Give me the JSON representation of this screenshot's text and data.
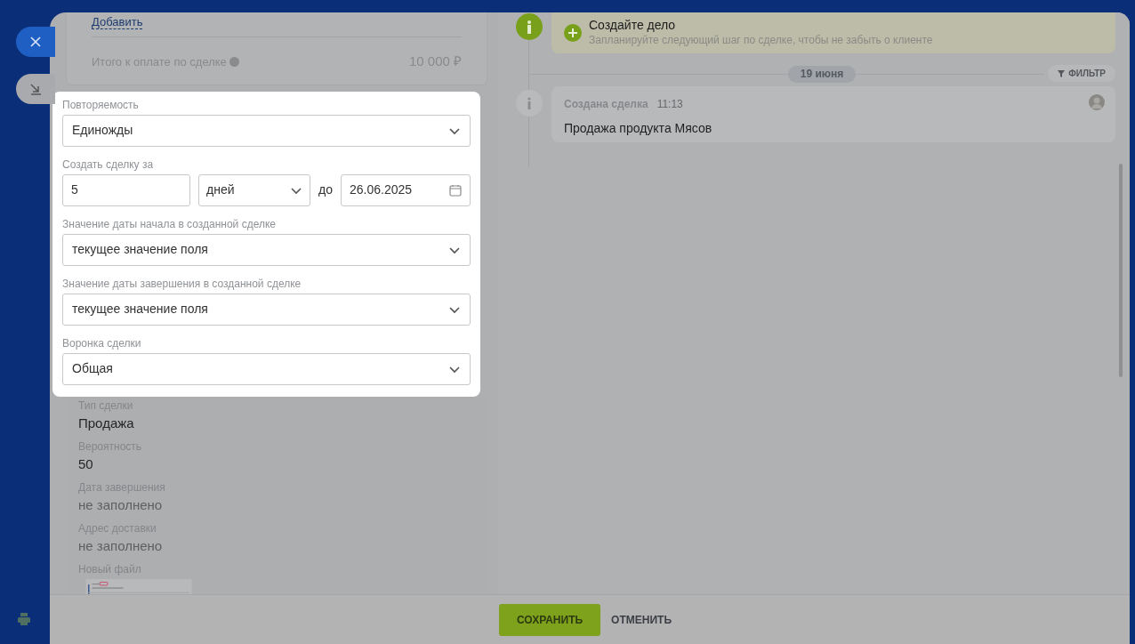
{
  "products_footer": {
    "add_link": "Добавить",
    "total_label": "Итого к оплате по сделке",
    "total_value": "10 000 ₽"
  },
  "recurrence_form": {
    "fields": [
      {
        "kind": "select",
        "label": "Повторяемость",
        "value": "Единожды"
      },
      {
        "kind": "period",
        "label": "Создать сделку за",
        "count": "5",
        "unit": "дней",
        "separator": "до",
        "date": "26.06.2025"
      },
      {
        "kind": "select",
        "label": "Значение даты начала в созданной сделке",
        "value": "текущее значение поля"
      },
      {
        "kind": "select",
        "label": "Значение даты завершения в созданной сделке",
        "value": "текущее значение поля"
      },
      {
        "kind": "select",
        "label": "Воронка сделки",
        "value": "Общая"
      }
    ]
  },
  "deal_fields": [
    {
      "label": "Тип сделки",
      "value": "Продажа",
      "empty": false
    },
    {
      "label": "Вероятность",
      "value": "50",
      "empty": false
    },
    {
      "label": "Дата завершения",
      "value": "не заполнено",
      "empty": true
    },
    {
      "label": "Адрес доставки",
      "value": "не заполнено",
      "empty": true
    }
  ],
  "file_field": {
    "label": "Новый файл"
  },
  "timeline": {
    "todo": {
      "title": "Создайте дело",
      "hint": "Запланируйте следующий шаг по сделке, чтобы не забыть о клиенте"
    },
    "date": "19 июня",
    "filter": "ФИЛЬТР",
    "events": [
      {
        "title": "Создана сделка",
        "time": "11:13",
        "text": "Продажа продукта Мясов"
      }
    ]
  },
  "footer": {
    "buttons": [
      {
        "label": "СОХРАНИТЬ",
        "kind": "primary"
      },
      {
        "label": "ОТМЕНИТЬ",
        "kind": "link"
      }
    ]
  }
}
